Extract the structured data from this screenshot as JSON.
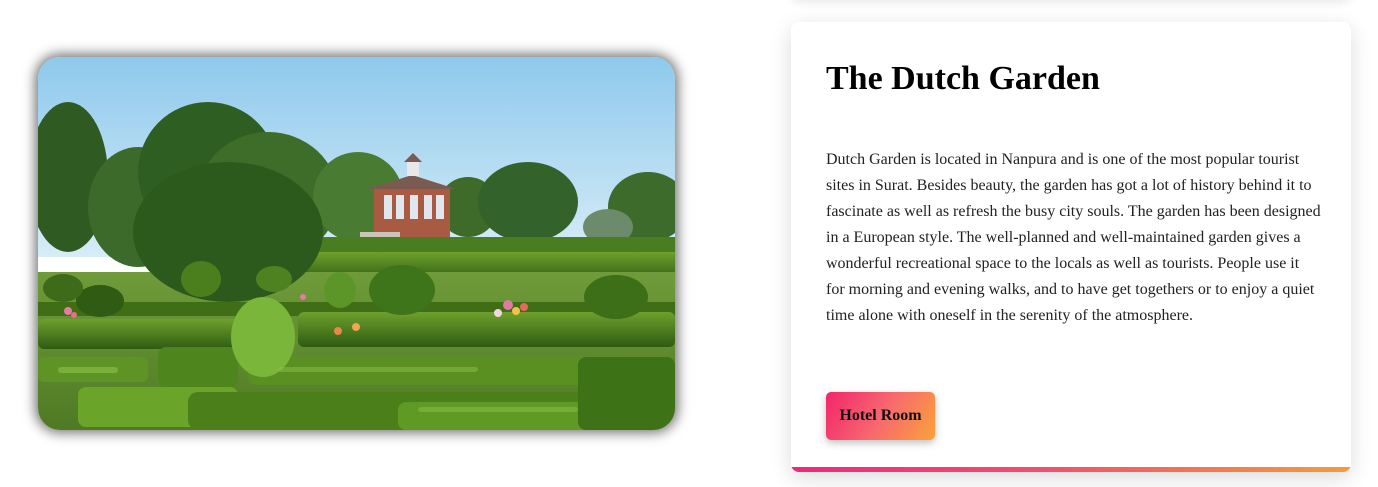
{
  "photo": {
    "alt": "Formal hedge garden with a small red brick pavilion"
  },
  "card": {
    "title": "The Dutch Garden",
    "description": "Dutch Garden is located in Nanpura and is one of the most popular tourist sites in Surat. Besides beauty, the garden has got a lot of history behind it to fascinate as well as refresh the busy city souls. The garden has been designed in a European style. The well-planned and well-maintained garden gives a wonderful recreational space to the locals as well as tourists. People use it for morning and evening walks, and to have get togethers or to enjoy a quiet time alone with oneself in the serenity of the atmosphere.",
    "button_label": "Hotel Room"
  },
  "colors": {
    "button_gradient_start": "#f2256b",
    "button_gradient_end": "#fba13a",
    "accent_bar_start": "#ea2a7d",
    "accent_bar_end": "#f39c3b"
  }
}
